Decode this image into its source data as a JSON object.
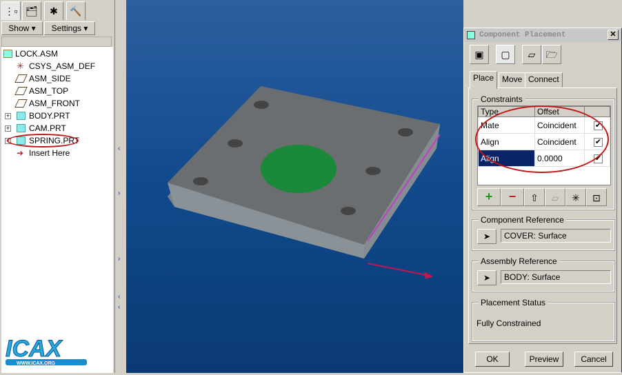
{
  "left_panel": {
    "tabs": [
      "model-tree-icon",
      "layers-icon",
      "folder-icon",
      "tools-icon"
    ],
    "show_label": "Show",
    "settings_label": "Settings",
    "tree": [
      {
        "label": "LOCK.ASM",
        "icon": "assembly-icon"
      },
      {
        "label": "CSYS_ASM_DEF",
        "icon": "csys-icon"
      },
      {
        "label": "ASM_SIDE",
        "icon": "datum-plane-icon"
      },
      {
        "label": "ASM_TOP",
        "icon": "datum-plane-icon"
      },
      {
        "label": "ASM_FRONT",
        "icon": "datum-plane-icon"
      },
      {
        "label": "BODY.PRT",
        "icon": "part-icon"
      },
      {
        "label": "CAM.PRT",
        "icon": "part-icon"
      },
      {
        "label": "SPRING.PRT",
        "icon": "part-icon"
      },
      {
        "label": "Insert Here",
        "icon": "insert-arrow-icon"
      }
    ],
    "logo_text": "ICAX WWW.ICAX.ORG"
  },
  "dialog": {
    "title": "Component Placement",
    "tabs": [
      "Place",
      "Move",
      "Connect"
    ],
    "constraints_label": "Constraints",
    "columns": [
      "Type",
      "Offset"
    ],
    "rows": [
      {
        "type": "Mate",
        "offset": "Coincident",
        "checked": true
      },
      {
        "type": "Align",
        "offset": "Coincident",
        "checked": true
      },
      {
        "type": "Align",
        "offset": "0.0000",
        "checked": true
      }
    ],
    "component_reference_label": "Component Reference",
    "component_reference": "COVER: Surface",
    "assembly_reference_label": "Assembly Reference",
    "assembly_reference": "BODY: Surface",
    "placement_status_label": "Placement Status",
    "placement_status": "Fully Constrained",
    "ok": "OK",
    "preview": "Preview",
    "cancel": "Cancel"
  }
}
